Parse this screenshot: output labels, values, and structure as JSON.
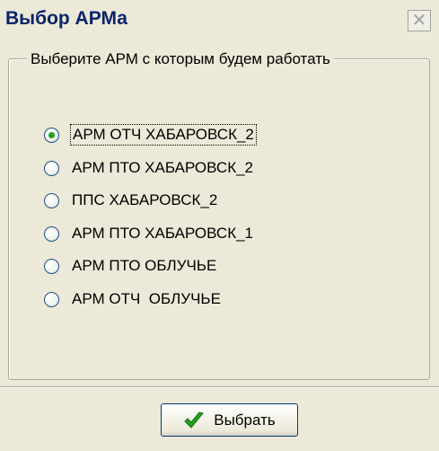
{
  "window": {
    "title": "Выбор АРМа",
    "close_glyph": "✕"
  },
  "group": {
    "legend": "Выберите АРМ с которым будем работать"
  },
  "options": [
    {
      "label": "АРМ ОТЧ ХАБАРОВСК_2",
      "selected": true
    },
    {
      "label": "АРМ ПТО ХАБАРОВСК_2",
      "selected": false
    },
    {
      "label": "ППС ХАБАРОВСК_2",
      "selected": false
    },
    {
      "label": "АРМ ПТО ХАБАРОВСК_1",
      "selected": false
    },
    {
      "label": "АРМ ПТО ОБЛУЧЬЕ",
      "selected": false
    },
    {
      "label": "АРМ ОТЧ  ОБЛУЧЬЕ",
      "selected": false
    }
  ],
  "footer": {
    "select_label": "Выбрать",
    "select_icon": "check-icon"
  },
  "colors": {
    "accent_check": "#21a121",
    "title_text": "#0a246a"
  }
}
